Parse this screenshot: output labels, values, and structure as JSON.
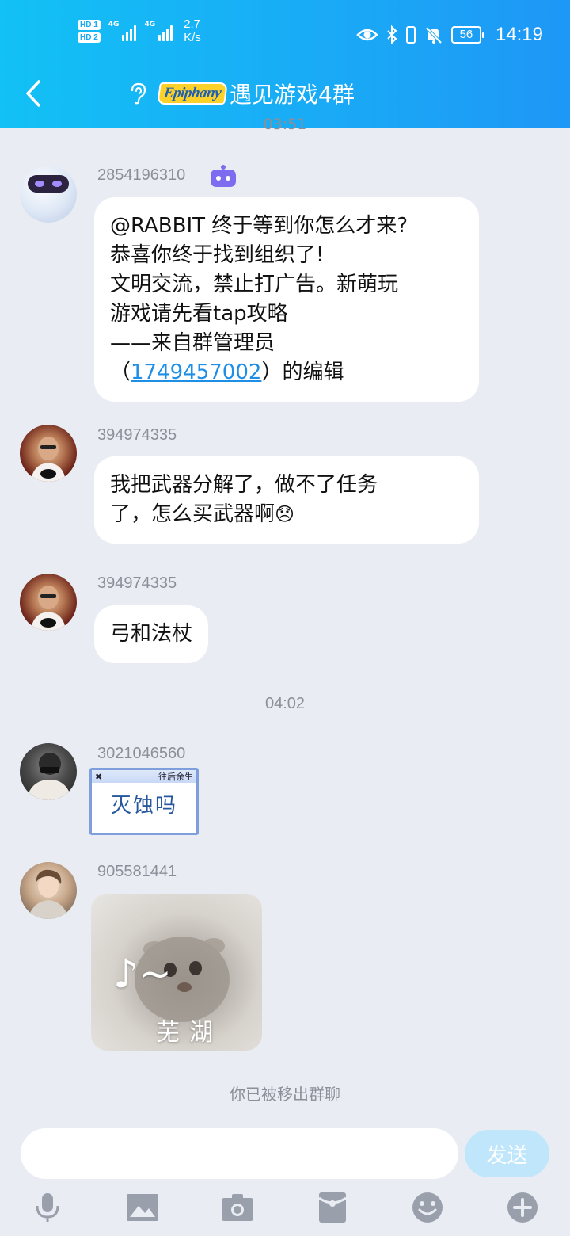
{
  "status_bar": {
    "sim1": "HD 1",
    "sim2": "HD 2",
    "signal_label_1": "4G",
    "signal_label_2": "4G",
    "net_speed_value": "2.7",
    "net_speed_unit": "K/s",
    "battery": "56",
    "time": "14:19",
    "icons": [
      "eye-icon",
      "bluetooth-icon",
      "vibrate-icon",
      "mute-bell-icon"
    ]
  },
  "header": {
    "logo_text": "Epiphany",
    "title": "遇见游戏4群",
    "colors": {
      "gradient_start": "#12c1f5",
      "gradient_end": "#1e97f6"
    }
  },
  "messages": {
    "clipped_time": "03:51",
    "m1": {
      "sender": "2854196310",
      "lines": [
        "@RABBIT 终于等到你怎么才来?",
        "恭喜你终于找到组织了!",
        "文明交流，禁止打广告。新萌玩",
        "游戏请先看tap攻略",
        "——来自群管理员"
      ],
      "last_prefix": "（",
      "link_qq": "1749457002",
      "last_suffix": "）的编辑"
    },
    "m2": {
      "sender": "394974335",
      "line1": "我把武器分解了，做不了任务",
      "line2": "了，怎么买武器啊",
      "emoji": "😞"
    },
    "m3": {
      "sender": "394974335",
      "text": "弓和法杖"
    },
    "time_divider": "04:02",
    "m4": {
      "sender": "3021046560",
      "sticker_header": "往后余生",
      "sticker_text": "灭蚀吗"
    },
    "m5": {
      "sender": "905581441",
      "sticker_caption": "芜湖",
      "sticker_note": "♪~"
    },
    "removed_notice": "你已被移出群聊"
  },
  "input": {
    "placeholder": "",
    "send_label": "发送"
  },
  "toolbar": {
    "items": [
      "microphone-icon",
      "image-icon",
      "camera-icon",
      "red-packet-icon",
      "emoji-icon",
      "plus-icon"
    ]
  }
}
